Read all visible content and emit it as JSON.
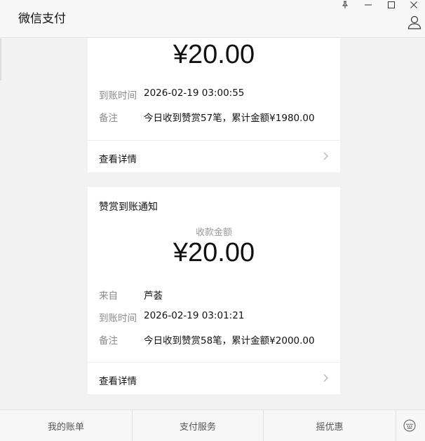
{
  "window": {
    "title": "微信支付",
    "controls": [
      "pin-icon",
      "minimize-icon",
      "maximize-icon",
      "close-icon"
    ],
    "user_icon": "user-icon"
  },
  "cards": [
    {
      "amount": "¥20.00",
      "rows": [
        {
          "label": "到账时间",
          "value": "2026-02-19 03:00:55"
        },
        {
          "label": "备注",
          "value": "今日收到赞赏57笔，累计金额¥1980.00"
        }
      ],
      "detail_label": "查看详情"
    },
    {
      "title": "赞赏到账通知",
      "amount_label": "收款金额",
      "amount": "¥20.00",
      "rows": [
        {
          "label": "来自",
          "value": "芦荟"
        },
        {
          "label": "到账时间",
          "value": "2026-02-19 03:01:21"
        },
        {
          "label": "备注",
          "value": "今日收到赞赏58笔，累计金额¥2000.00"
        }
      ],
      "detail_label": "查看详情"
    }
  ],
  "bottom_tabs": [
    "我的账单",
    "支付服务",
    "摇优惠"
  ],
  "colors": {
    "background": "#f2f2f2",
    "card": "#ffffff",
    "muted": "#8a8a8a"
  }
}
